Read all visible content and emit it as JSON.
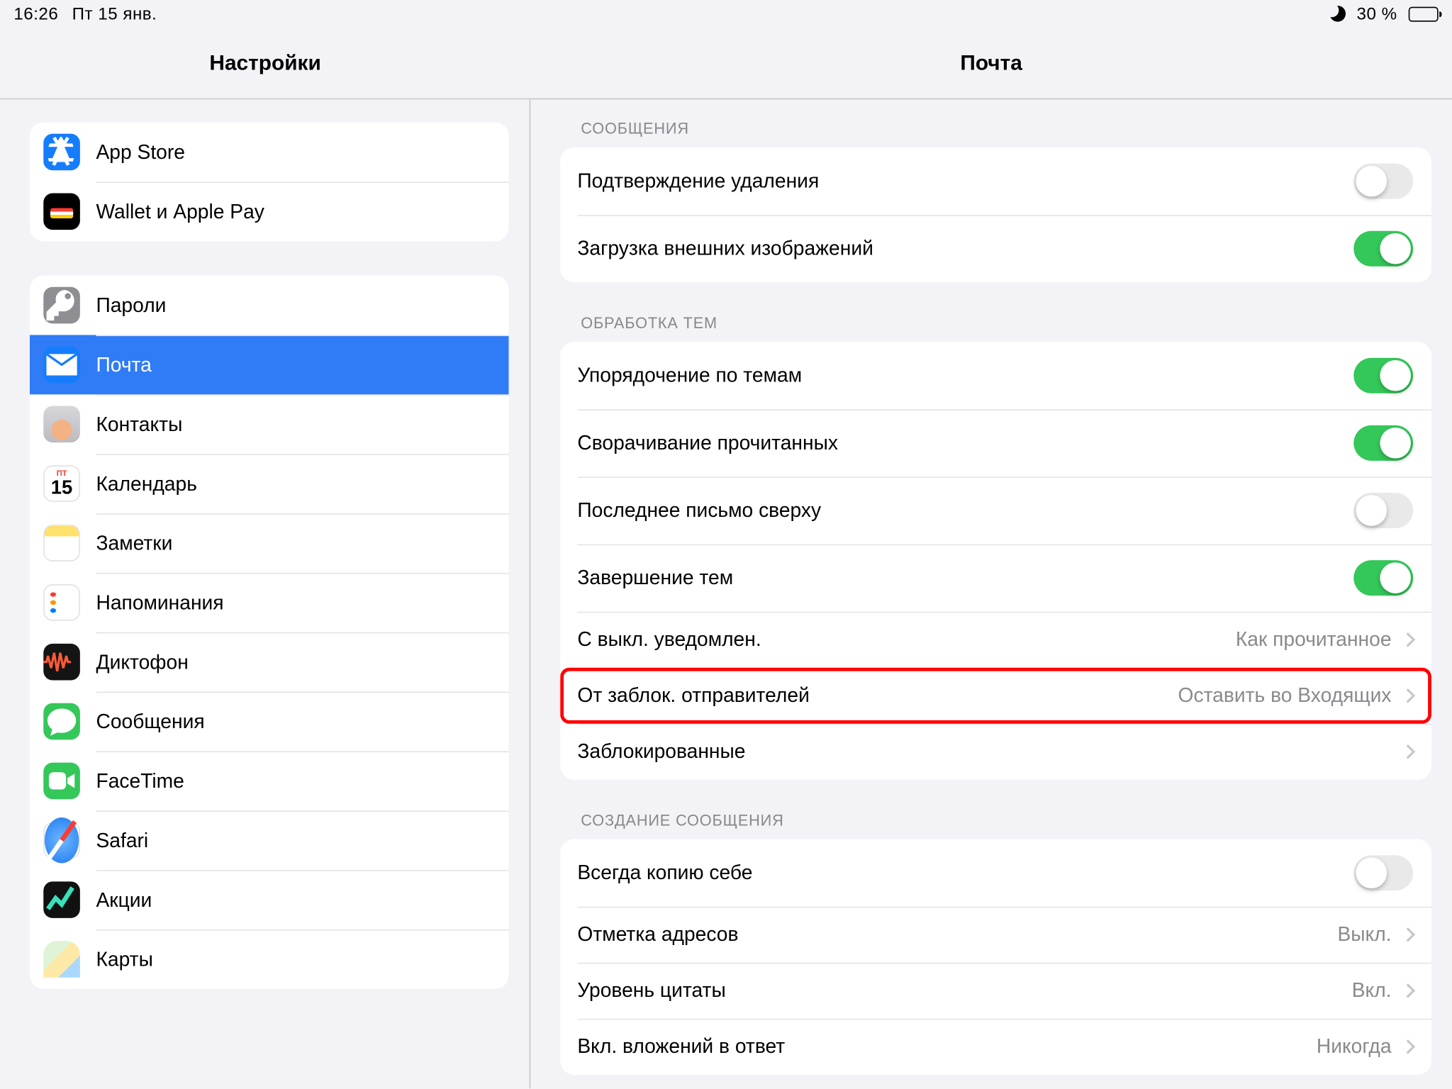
{
  "status": {
    "time": "16:26",
    "date": "Пт 15 янв.",
    "battery": "30 %",
    "dnd": true
  },
  "titles": {
    "left": "Настройки",
    "right": "Почта"
  },
  "sidebar": {
    "group1": [
      {
        "id": "appstore",
        "label": "App Store"
      },
      {
        "id": "wallet",
        "label": "Wallet и Apple Pay"
      }
    ],
    "group2": [
      {
        "id": "passwords",
        "label": "Пароли"
      },
      {
        "id": "mail",
        "label": "Почта",
        "selected": true
      },
      {
        "id": "contacts",
        "label": "Контакты"
      },
      {
        "id": "calendar",
        "label": "Календарь",
        "mon": "ПТ",
        "day": "15"
      },
      {
        "id": "notes",
        "label": "Заметки"
      },
      {
        "id": "reminders",
        "label": "Напоминания"
      },
      {
        "id": "voice",
        "label": "Диктофон"
      },
      {
        "id": "messages",
        "label": "Сообщения"
      },
      {
        "id": "facetime",
        "label": "FaceTime"
      },
      {
        "id": "safari",
        "label": "Safari"
      },
      {
        "id": "stocks",
        "label": "Акции"
      },
      {
        "id": "maps",
        "label": "Карты"
      }
    ]
  },
  "content": {
    "messages": {
      "header": "Сообщения",
      "rows": [
        {
          "id": "ask_delete",
          "label": "Подтверждение удаления",
          "toggle": false
        },
        {
          "id": "load_remote",
          "label": "Загрузка внешних изображений",
          "toggle": true
        }
      ]
    },
    "threading": {
      "header": "Обработка тем",
      "rows": [
        {
          "id": "organize",
          "label": "Упорядочение по темам",
          "toggle": true
        },
        {
          "id": "collapse",
          "label": "Сворачивание прочитанных",
          "toggle": true
        },
        {
          "id": "recent_top",
          "label": "Последнее письмо сверху",
          "toggle": false
        },
        {
          "id": "complete",
          "label": "Завершение тем",
          "toggle": true
        },
        {
          "id": "muted",
          "label": "С выкл. уведомлен.",
          "value": "Как прочитанное"
        },
        {
          "id": "blocked_sender",
          "label": "От заблок. отправителей",
          "value": "Оставить во Входящих",
          "hl": true
        },
        {
          "id": "blocked",
          "label": "Заблокированные"
        }
      ]
    },
    "composing": {
      "header": "Создание сообщения",
      "rows": [
        {
          "id": "bcc_self",
          "label": "Всегда копию себе",
          "toggle": false
        },
        {
          "id": "mark_addr",
          "label": "Отметка адресов",
          "value": "Выкл."
        },
        {
          "id": "quote_lvl",
          "label": "Уровень цитаты",
          "value": "Вкл."
        },
        {
          "id": "attach_reply",
          "label": "Вкл. вложений в ответ",
          "value": "Никогда"
        }
      ]
    }
  }
}
